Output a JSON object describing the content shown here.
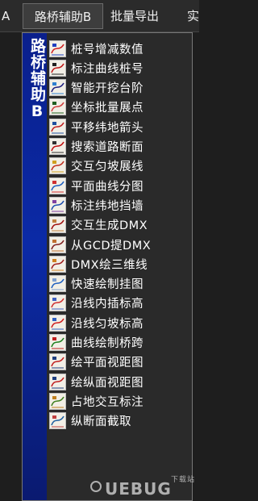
{
  "menubar": {
    "left_fragment": "A",
    "active_menu": "路桥辅助B",
    "batch_export": "批量导出",
    "right_fragment": "实"
  },
  "dropdown": {
    "side_title": "路桥辅助B",
    "items": [
      {
        "label": "桩号增减数值",
        "icon": "k-plus-icon"
      },
      {
        "label": "标注曲线桩号",
        "icon": "k-curve-icon"
      },
      {
        "label": "智能开挖台阶",
        "icon": "step-excavation-icon"
      },
      {
        "label": "坐标批量展点",
        "icon": "points-icon"
      },
      {
        "label": "平移纬地箭头",
        "icon": "arrow-move-icon"
      },
      {
        "label": "搜索道路断面",
        "icon": "wid-search-icon"
      },
      {
        "label": "交互匀坡展线",
        "icon": "slope-line-icon"
      },
      {
        "label": "平面曲线分图",
        "icon": "curve-split-icon"
      },
      {
        "label": "标注纬地挡墙",
        "icon": "retaining-wall-icon"
      },
      {
        "label": "交互生成DMX",
        "icon": "dmx-generate-icon"
      },
      {
        "label": "从GCD提DMX",
        "icon": "dmx-extract-icon"
      },
      {
        "label": "DMX绘三维线",
        "icon": "dmx-3d-icon"
      },
      {
        "label": "快速绘制挂图",
        "icon": "chart-draw-icon"
      },
      {
        "label": "沿线内插标高",
        "icon": "interpolate-icon"
      },
      {
        "label": "沿线匀坡标高",
        "icon": "uniform-slope-icon"
      },
      {
        "label": "曲线绘制桥跨",
        "icon": "bridge-span-icon"
      },
      {
        "label": "绘平面视距图",
        "icon": "plan-sight-icon"
      },
      {
        "label": "绘纵面视距图",
        "icon": "profile-sight-icon"
      },
      {
        "label": "占地交互标注",
        "icon": "land-annotate-icon"
      },
      {
        "label": "纵断面截取",
        "icon": "profile-cut-icon"
      }
    ]
  },
  "watermark": {
    "brand": "UEBUG",
    "tag": "下载站"
  }
}
